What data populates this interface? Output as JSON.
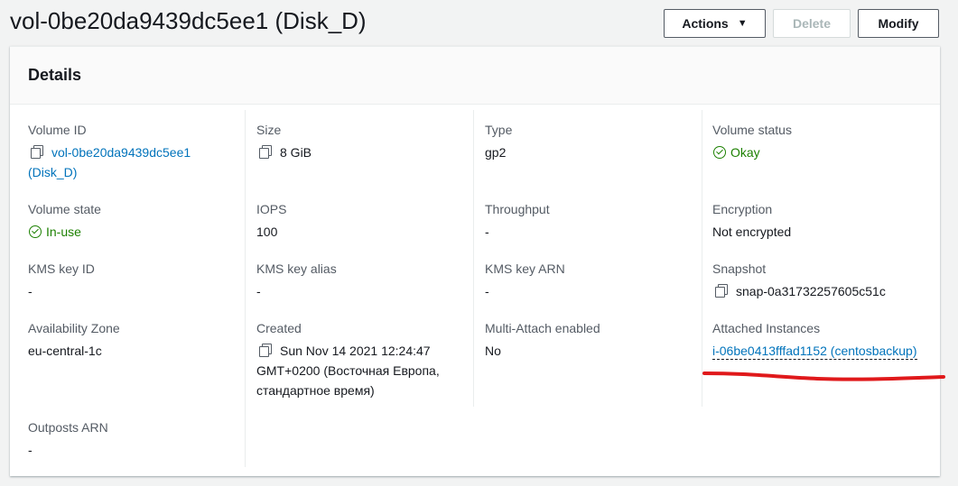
{
  "header": {
    "title": "vol-0be20da9439dc5ee1 (Disk_D)",
    "actions_label": "Actions",
    "delete_label": "Delete",
    "modify_label": "Modify"
  },
  "panel": {
    "title": "Details"
  },
  "fields": {
    "volume_id": {
      "label": "Volume ID",
      "value_line1": "vol-0be20da9439dc5ee1",
      "value_line2": "(Disk_D)"
    },
    "size": {
      "label": "Size",
      "value": "8 GiB"
    },
    "type": {
      "label": "Type",
      "value": "gp2"
    },
    "volume_status": {
      "label": "Volume status",
      "value": "Okay"
    },
    "volume_state": {
      "label": "Volume state",
      "value": "In-use"
    },
    "iops": {
      "label": "IOPS",
      "value": "100"
    },
    "throughput": {
      "label": "Throughput",
      "value": "-"
    },
    "encryption": {
      "label": "Encryption",
      "value": "Not encrypted"
    },
    "kms_key_id": {
      "label": "KMS key ID",
      "value": "-"
    },
    "kms_key_alias": {
      "label": "KMS key alias",
      "value": "-"
    },
    "kms_key_arn": {
      "label": "KMS key ARN",
      "value": "-"
    },
    "snapshot": {
      "label": "Snapshot",
      "value": "snap-0a31732257605c51c"
    },
    "availability_zone": {
      "label": "Availability Zone",
      "value": "eu-central-1c"
    },
    "created": {
      "label": "Created",
      "value_line1": "Sun Nov 14 2021 12:24:47",
      "value_line2": "GMT+0200 (Восточная Европа,",
      "value_line3": "стандартное время)"
    },
    "multi_attach": {
      "label": "Multi-Attach enabled",
      "value": "No"
    },
    "attached_instances": {
      "label": "Attached Instances",
      "value": "i-06be0413fffad1152 (centosbackup)"
    },
    "outposts_arn": {
      "label": "Outposts ARN",
      "value": "-"
    }
  },
  "colors": {
    "link": "#0073bb",
    "success": "#1d8102",
    "annotation_stroke": "#e0191b"
  },
  "icons": [
    "copy-icon",
    "check-circle-icon",
    "caret-down-icon"
  ]
}
